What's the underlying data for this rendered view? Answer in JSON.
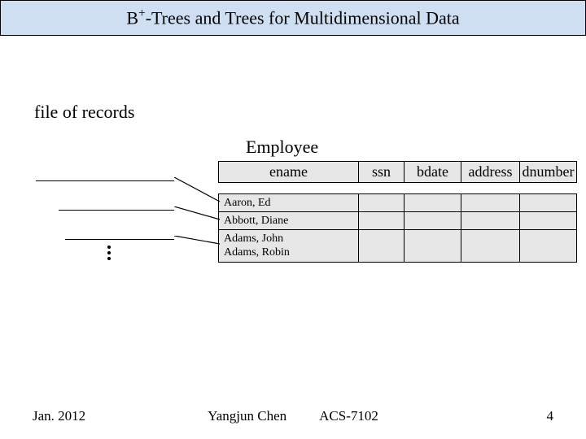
{
  "title": {
    "pre": "B",
    "sup": "+",
    "post": "-Trees and Trees for Multidimensional Data"
  },
  "section_label": "file of records",
  "table_title": "Employee",
  "columns": [
    "ename",
    "ssn",
    "bdate",
    "address",
    "dnumber"
  ],
  "records": [
    {
      "ename": "Aaron, Ed"
    },
    {
      "ename": "Abbott, Diane"
    },
    {
      "ename_line1": "Adams, John",
      "ename_line2": "Adams, Robin"
    }
  ],
  "footer": {
    "date": "Jan. 2012",
    "author": "Yangjun Chen",
    "course": "ACS-7102",
    "page": "4"
  }
}
